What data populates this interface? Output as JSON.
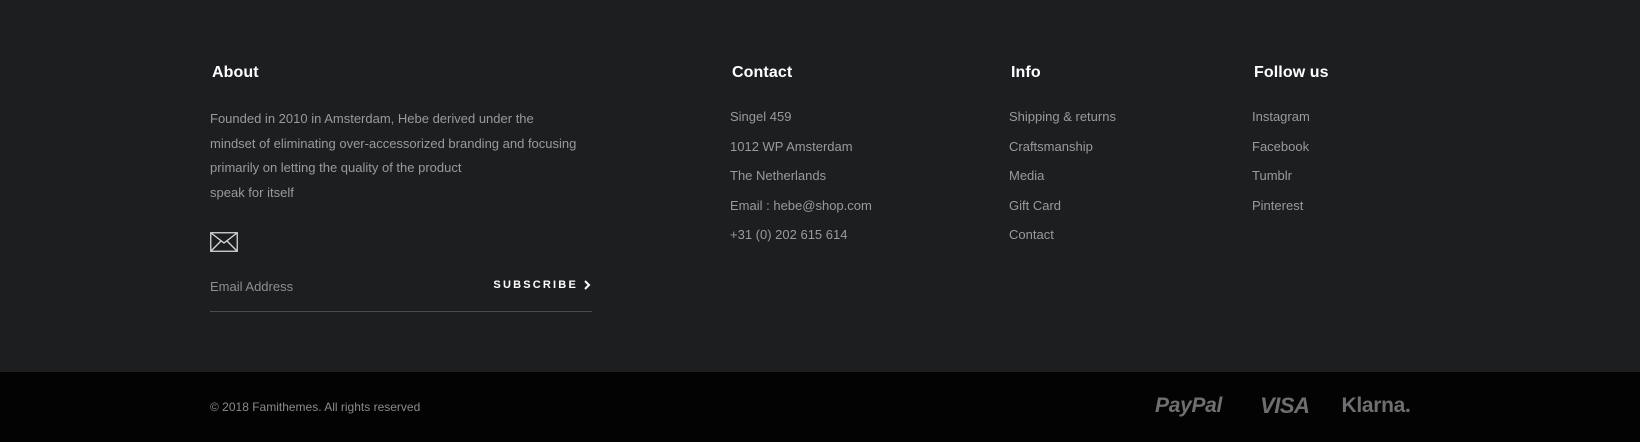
{
  "about": {
    "heading": "About",
    "lines": [
      "Founded in 2010 in Amsterdam, Hebe derived under the",
      "mindset of eliminating over-accessorized branding and focusing",
      "primarily on letting the quality of the product",
      "speak for itself"
    ],
    "mail_icon": "envelope-icon",
    "email_placeholder": "Email Address",
    "email_value": "",
    "subscribe_label": "SUBSCRIBE",
    "subscribe_icon": "chevron-right-icon"
  },
  "contact": {
    "heading": "Contact",
    "items": [
      "Singel 459",
      "1012 WP Amsterdam",
      "The Netherlands",
      "Email : hebe@shop.com",
      "+31 (0) 202 615 614"
    ]
  },
  "info": {
    "heading": "Info",
    "items": [
      "Shipping & returns",
      "Craftsmanship",
      "Media",
      "Gift Card",
      "Contact"
    ]
  },
  "follow": {
    "heading": "Follow us",
    "items": [
      "Instagram",
      "Facebook",
      "Tumblr",
      "Pinterest"
    ]
  },
  "bottom": {
    "copyright": "© 2018 Famithemes. All rights reserved",
    "payments": [
      "PayPal",
      "VISA",
      "Klarna."
    ]
  },
  "colors": {
    "footer_bg": "#1d1e20",
    "bottom_bg": "#030303",
    "heading": "#ffffff",
    "text": "#9a9a9c",
    "payment_logo": "#6f6f71"
  }
}
